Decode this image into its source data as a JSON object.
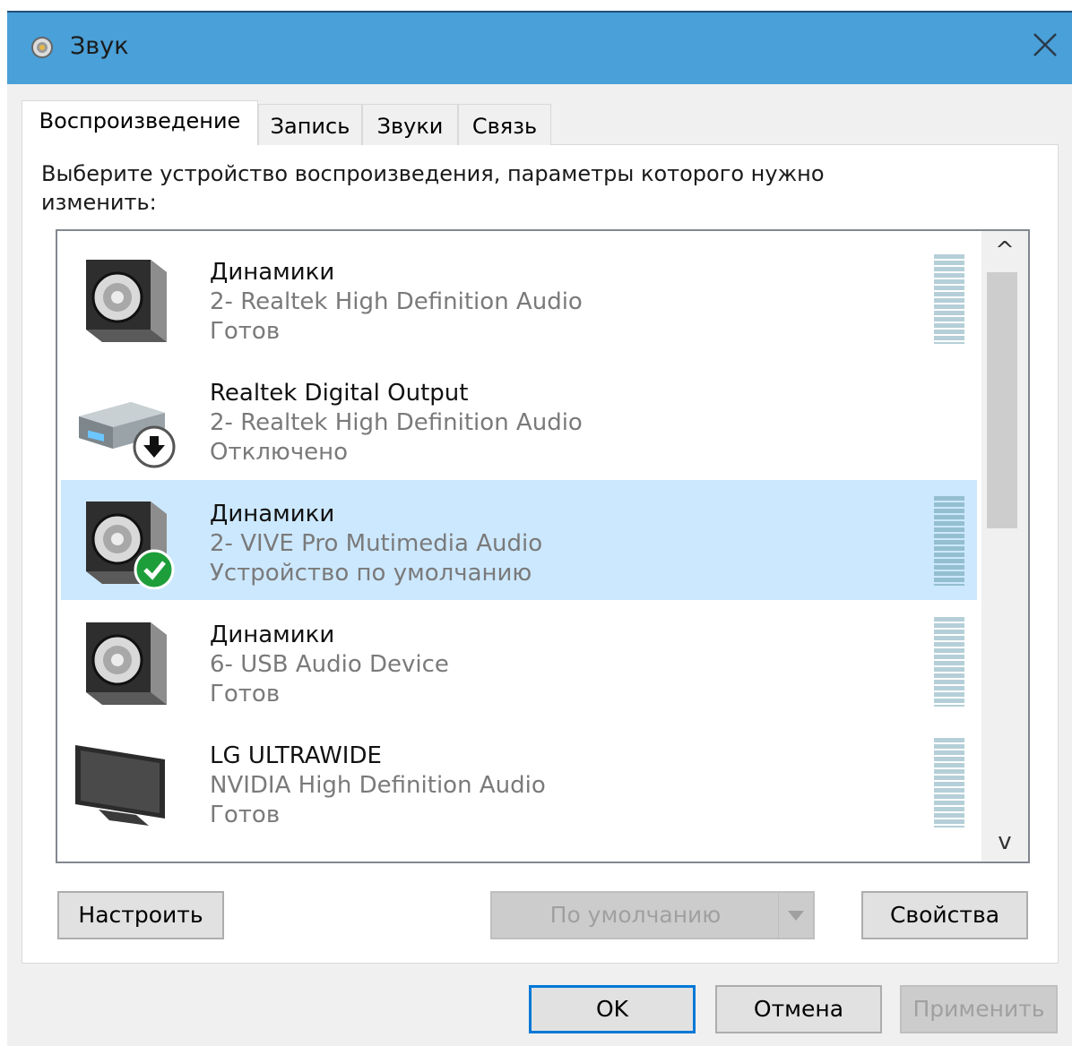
{
  "window": {
    "title": "Звук",
    "icon": "speaker-icon",
    "close_icon": "close-icon"
  },
  "tabs": [
    {
      "label": "Воспроизведение",
      "active": true
    },
    {
      "label": "Запись",
      "active": false
    },
    {
      "label": "Звуки",
      "active": false
    },
    {
      "label": "Связь",
      "active": false
    }
  ],
  "instruction": "Выберите устройство воспроизведения, параметры которого нужно изменить:",
  "devices": [
    {
      "name": "Динамики",
      "driver": "2- Realtek High Definition Audio",
      "status": "Готов",
      "icon": "speaker-icon",
      "badge": "",
      "selected": false
    },
    {
      "name": "Realtek Digital Output",
      "driver": "2- Realtek High Definition Audio",
      "status": "Отключено",
      "icon": "digital-output-icon",
      "badge": "disabled-arrow-icon",
      "selected": false
    },
    {
      "name": "Динамики",
      "driver": "2- VIVE Pro Mutimedia Audio",
      "status": "Устройство по умолчанию",
      "icon": "speaker-icon",
      "badge": "default-check-icon",
      "selected": true
    },
    {
      "name": "Динамики",
      "driver": "6- USB Audio Device",
      "status": "Готов",
      "icon": "speaker-icon",
      "badge": "",
      "selected": false
    },
    {
      "name": "LG ULTRAWIDE",
      "driver": "NVIDIA High Definition Audio",
      "status": "Готов",
      "icon": "monitor-icon",
      "badge": "",
      "selected": false
    }
  ],
  "scroll": {
    "up": "^",
    "down": "v"
  },
  "buttons": {
    "configure": "Настроить",
    "set_default": "По умолчанию",
    "properties": "Свойства",
    "ok": "OK",
    "cancel": "Отмена",
    "apply": "Применить"
  },
  "colors": {
    "title_bar": "#4aa0d8",
    "selection": "#cce8ff",
    "default_badge": "#1e9e3a",
    "primary_border": "#0078d7"
  }
}
